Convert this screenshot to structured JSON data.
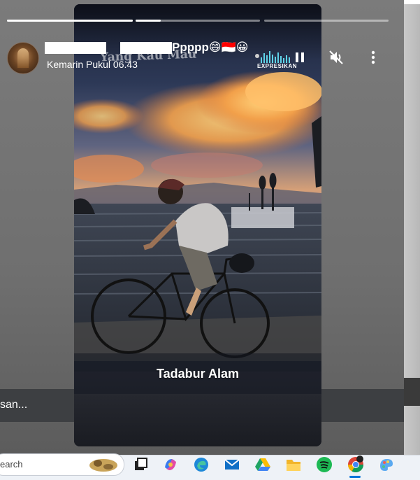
{
  "story": {
    "username_suffix": "Ppppp",
    "username_emojis": [
      "😄",
      "🇮🇩",
      "😀"
    ],
    "timestamp": "Kemarin Pukul 06.43",
    "overlay_title": "Yang Kau Mau",
    "caption": "Tadabur Alam",
    "sticker_label": "EXPRESIKAN",
    "progress_segments": [
      {
        "state": "complete",
        "fill_fraction": 1.0
      },
      {
        "state": "current",
        "fill_fraction": 0.2
      },
      {
        "state": "upcoming",
        "fill_fraction": 0.0
      }
    ]
  },
  "controls": {
    "pause_icon": "pause-icon",
    "mute_icon": "volume-muted-icon",
    "more_icon": "more-vertical-icon"
  },
  "background_page": {
    "bottom_text": "san..."
  },
  "taskbar": {
    "search_text": "earch",
    "apps": [
      {
        "name": "task-view-icon"
      },
      {
        "name": "copilot-icon"
      },
      {
        "name": "edge-icon"
      },
      {
        "name": "mail-icon"
      },
      {
        "name": "google-drive-icon"
      },
      {
        "name": "file-explorer-icon"
      },
      {
        "name": "spotify-icon"
      },
      {
        "name": "chrome-icon",
        "active": true
      },
      {
        "name": "paint-icon"
      }
    ]
  },
  "colors": {
    "sky_orange": "#f2a04a",
    "story_bg": "#141a27",
    "taskbar_bg": "#eef2f7",
    "active_indicator": "#0a74da"
  }
}
